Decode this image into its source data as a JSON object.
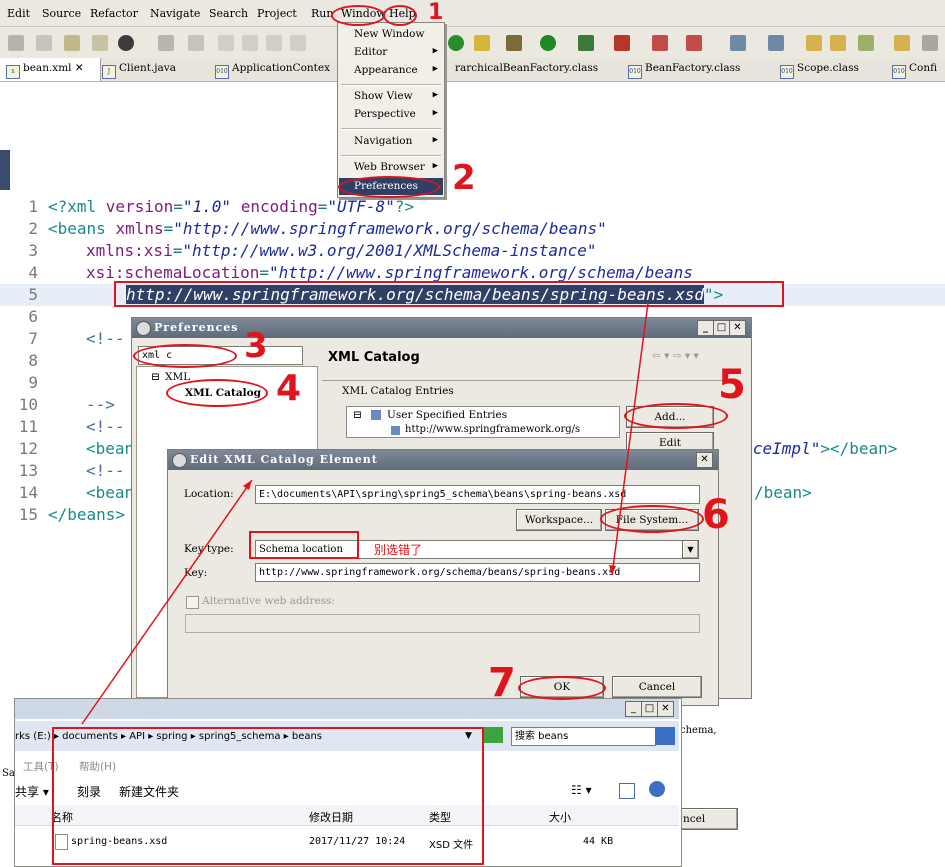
{
  "menubar": {
    "items": [
      "Edit",
      "Source",
      "Refactor",
      "Navigate",
      "Search",
      "Project",
      "Run",
      "Window",
      "Help"
    ]
  },
  "tabs": [
    "bean.xml",
    "Client.java",
    "ApplicationContex",
    "rarchicalBeanFactory.class",
    "BeanFactory.class",
    "Scope.class",
    "Confi"
  ],
  "window_menu": {
    "items": [
      "New Window",
      "Editor",
      "Appearance",
      "Show View",
      "Perspective",
      "Navigation",
      "Web Browser",
      "Preferences"
    ]
  },
  "editor": {
    "line_numbers": [
      "1",
      "2",
      "3",
      "4",
      "5",
      "6",
      "7",
      "8",
      "9",
      "10",
      "11",
      "12",
      "13",
      "14",
      "15"
    ],
    "line1": {
      "open": "<?xml ",
      "attr1": "version",
      "eq1": "=",
      "val1": "\"1.0\"",
      "sp": " ",
      "attr2": "encoding",
      "eq2": "=",
      "val2": "\"UTF-8\"",
      "close": "?>"
    },
    "line2": {
      "tag": "<beans ",
      "attr": "xmlns",
      "eq": "=",
      "val": "\"http://www.springframework.org/schema/beans\""
    },
    "line3": {
      "attr": "xmlns:xsi",
      "eq": "=",
      "val": "\"http://www.w3.org/2001/XMLSchema-instance\""
    },
    "line4": {
      "attr": "xsi:schemaLocation",
      "eq": "=",
      "val": "\"http://www.springframework.org/schema/beans"
    },
    "line5": {
      "val": "http://www.springframework.org/schema/beans/spring-beans.xsd",
      "close": "\">"
    },
    "line7": "<!--",
    "line10": "-->",
    "line11": "<!--",
    "line12": {
      "start": "<bean",
      "end_val": "rviceImpl\"",
      "end_tag": "></bean>"
    },
    "line13": "<!--",
    "line14": {
      "start": "<bean",
      "end": "/bean>"
    },
    "line15": "</beans>"
  },
  "preferences": {
    "title": "Preferences",
    "filter_value": "xml c",
    "tree_root": "XML",
    "tree_child": "XML Catalog",
    "page_title": "XML Catalog",
    "group_label": "XML Catalog Entries",
    "entries_root": "User Specified Entries",
    "entries_child": "http://www.springframework.org/s",
    "add_button": "Add...",
    "edit_button": "Edit",
    "right_partial": "chema,",
    "cancel_partial": "ncel"
  },
  "edit_dialog": {
    "title": "Edit XML Catalog Element",
    "location_label": "Location:",
    "location_value": "E:\\documents\\API\\spring\\spring5_schema\\beans\\spring-beans.xsd",
    "workspace_button": "Workspace...",
    "filesystem_button": "File System...",
    "keytype_label": "Key type:",
    "keytype_value": "Schema location",
    "key_label": "Key:",
    "key_value": "http://www.springframework.org/schema/beans/spring-beans.xsd",
    "alt_checkbox": "Alternative web address:",
    "ok_button": "OK",
    "cancel_button": "Cancel"
  },
  "explorer": {
    "breadcrumb": "rks (E:) ▸ documents ▸ API ▸ spring ▸ spring5_schema ▸ beans",
    "search_placeholder": "搜索 beans",
    "menu_tools": "工具(T)",
    "menu_help": "帮助(H)",
    "cmd_share": "共享 ▾",
    "cmd_burn": "刻录",
    "cmd_newfolder": "新建文件夹",
    "columns": [
      "名称",
      "修改日期",
      "类型",
      "大小"
    ],
    "rows": [
      {
        "name": "spring-beans.xsd",
        "date": "2017/11/27 10:24",
        "type": "XSD 文件",
        "size": "44 KB"
      }
    ]
  },
  "annotations": {
    "n1": "1",
    "n2": "2",
    "n3": "3",
    "n4": "4",
    "n5": "5",
    "n6": "6",
    "n7": "7",
    "note": "别选错了"
  },
  "colors": {
    "annotation_red": "#e0141c",
    "string_blue": "#1c2a9f",
    "selection": "#2f3f66"
  }
}
